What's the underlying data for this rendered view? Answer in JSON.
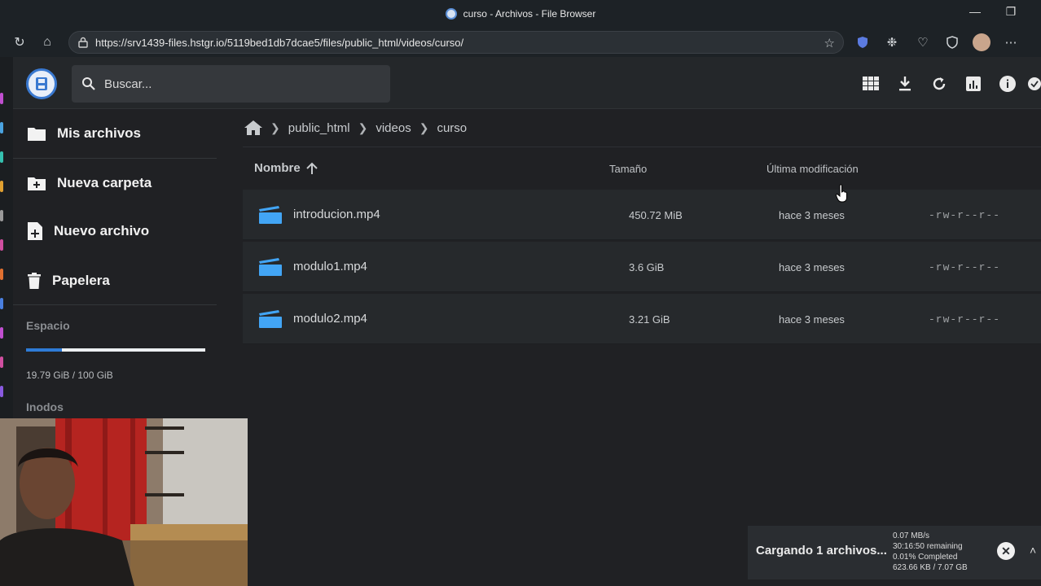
{
  "browser": {
    "title": "curso - Archivos - File Browser",
    "url": "https://srv1439-files.hstgr.io/5119bed1db7dcae5/files/public_html/videos/curso/"
  },
  "header": {
    "search_placeholder": "Buscar..."
  },
  "sidebar": {
    "items": [
      {
        "label": "Mis archivos",
        "icon": "folder-icon"
      },
      {
        "label": "Nueva carpeta",
        "icon": "new-folder-icon"
      },
      {
        "label": "Nuevo archivo",
        "icon": "new-file-icon"
      },
      {
        "label": "Papelera",
        "icon": "trash-icon"
      }
    ],
    "space_label": "Espacio",
    "space_used": "19.79 GiB / 100 GiB",
    "space_fraction": 0.198,
    "inodes_label": "Inodos"
  },
  "breadcrumb": [
    "public_html",
    "videos",
    "curso"
  ],
  "columns": {
    "name": "Nombre",
    "size": "Tamaño",
    "modified": "Última modificación"
  },
  "files": [
    {
      "name": "introducion.mp4",
      "size": "450.72 MiB",
      "modified": "hace 3 meses",
      "perms": "-rw-r--r--"
    },
    {
      "name": "modulo1.mp4",
      "size": "3.6 GiB",
      "modified": "hace 3 meses",
      "perms": "-rw-r--r--"
    },
    {
      "name": "modulo2.mp4",
      "size": "3.21 GiB",
      "modified": "hace 3 meses",
      "perms": "-rw-r--r--"
    }
  ],
  "upload": {
    "title": "Cargando 1 archivos...",
    "speed": "0.07 MB/s",
    "remaining": "30:16:50 remaining",
    "completed": "0.01% Completed",
    "transferred": "623.66 KB / 7.07 GB"
  },
  "colors": {
    "accent": "#2e7bd6",
    "video_icon": "#42a5f5",
    "background": "#202124"
  }
}
